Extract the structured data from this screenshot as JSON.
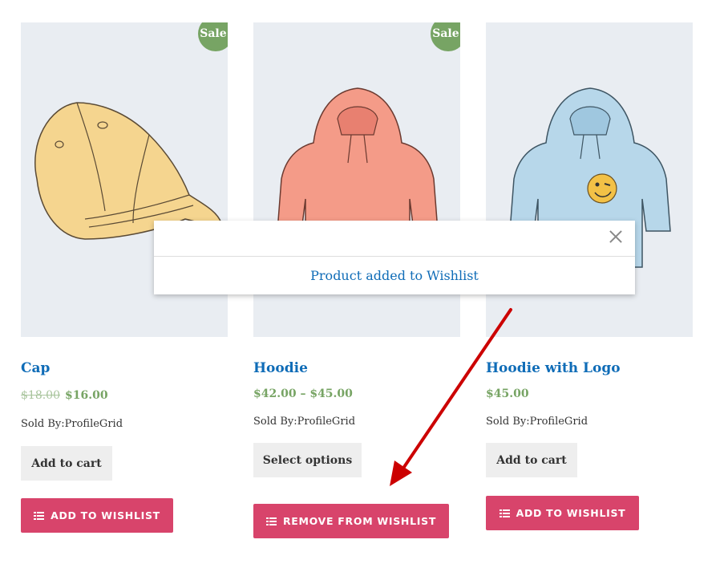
{
  "products": [
    {
      "name": "Cap",
      "sale_badge": "Sale!",
      "price_old": "$18.00",
      "price": "$16.00",
      "sold_by": "Sold By:ProfileGrid",
      "primary_button": "Add to cart",
      "wishlist_button": "ADD TO WISHLIST"
    },
    {
      "name": "Hoodie",
      "sale_badge": "Sale!",
      "price": "$42.00 – $45.00",
      "sold_by": "Sold By:ProfileGrid",
      "primary_button": "Select options",
      "wishlist_button": "REMOVE FROM WISHLIST"
    },
    {
      "name": "Hoodie with Logo",
      "price": "$45.00",
      "sold_by": "Sold By:ProfileGrid",
      "primary_button": "Add to cart",
      "wishlist_button": "ADD TO WISHLIST"
    }
  ],
  "popup": {
    "message": "Product added to Wishlist"
  },
  "colors": {
    "link": "#0f6cb7",
    "price": "#77a464",
    "sale_badge": "#77a464",
    "wishlist_button": "#d8446b",
    "annotation_arrow": "#cc0000"
  }
}
